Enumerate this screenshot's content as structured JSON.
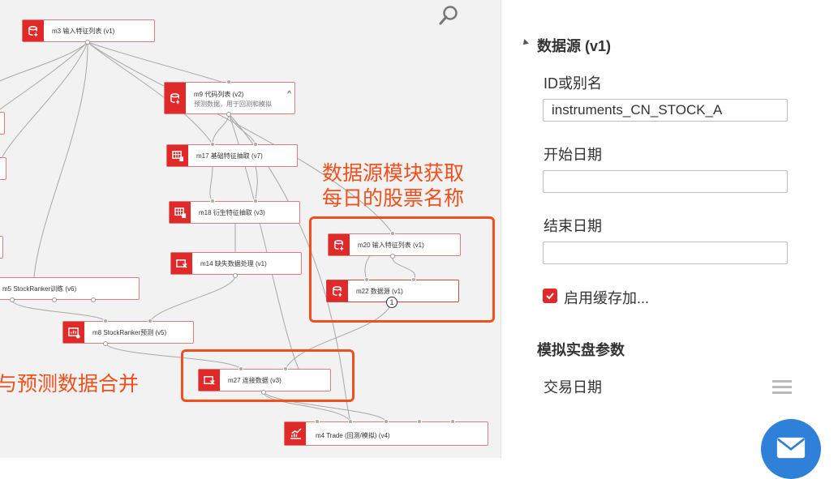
{
  "canvas": {
    "nodes": {
      "m3": {
        "label": "m3 输入特征列表 (v1)"
      },
      "m9": {
        "label": "m9 代码列表 (v2)",
        "sub": "预测数据，用于回测和模拟"
      },
      "m17": {
        "label": "m17 基础特征抽取 (v7)"
      },
      "m18": {
        "label": "m18 衍生特征抽取 (v3)"
      },
      "m14": {
        "label": "m14 缺失数据处理 (v1)"
      },
      "m5": {
        "label": "m5 StockRanker训练 (v6)"
      },
      "m8": {
        "label": "m8 StockRanker预测 (v5)"
      },
      "m20": {
        "label": "m20 输入特征列表 (v1)"
      },
      "m22": {
        "label": "m22 数据源 (v1)",
        "badge": "1"
      },
      "m27": {
        "label": "m27 连接数据 (v3)"
      },
      "m4": {
        "label": "m4 Trade (回测/模拟) (v4)"
      }
    },
    "annotations": {
      "source_line1": "数据源模块获取",
      "source_line2": "每日的股票名称",
      "merge": "与预测数据合并"
    },
    "accent": "#f0501e",
    "node_icon_color": "#e02a2a"
  },
  "panel": {
    "title": "数据源 (v1)",
    "fields": {
      "id_label": "ID或别名",
      "id_value": "instruments_CN_STOCK_A",
      "start_label": "开始日期",
      "start_value": "",
      "end_label": "结束日期",
      "end_value": ""
    },
    "cache": {
      "label": "启用缓存加...",
      "checked": true
    },
    "sim_section": "模拟实盘参数",
    "trade_date_label": "交易日期",
    "fab_color": "#2f80d8"
  }
}
